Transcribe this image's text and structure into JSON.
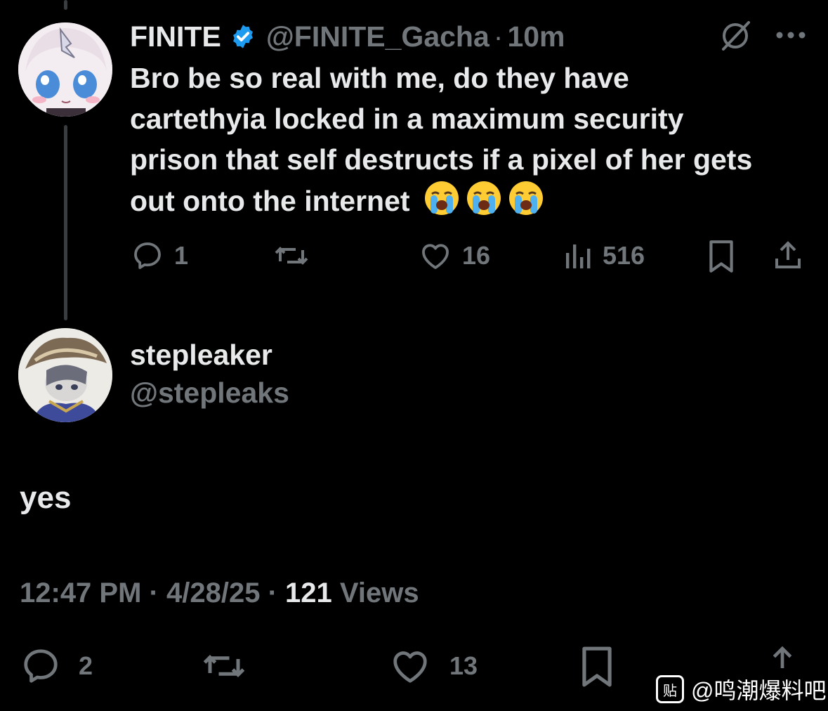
{
  "parent_tweet": {
    "display_name": "FINITE",
    "handle": "@FINITE_Gacha",
    "separator": "·",
    "time": "10m",
    "text": "Bro be so real with me, do they have cartethyia locked in a maximum security prison that self destructs if a pixel of her gets out onto the internet",
    "emojis": [
      "loudly-crying-face",
      "loudly-crying-face",
      "loudly-crying-face"
    ],
    "replies": "1",
    "likes": "16",
    "views": "516"
  },
  "reply_tweet": {
    "display_name": "stepleaker",
    "handle": "@stepleaks",
    "text": "yes",
    "time": "12:47 PM",
    "date": "4/28/25",
    "views_count": "121",
    "views_label": "Views",
    "sep1": "·",
    "sep2": "·",
    "replies": "2",
    "likes": "13"
  },
  "watermark": {
    "badge": "贴",
    "text": "@鸣潮爆料吧"
  },
  "colors": {
    "background": "#000000",
    "text": "#e7e9ea",
    "muted": "#71767b",
    "verified": "#1d9bf0"
  }
}
